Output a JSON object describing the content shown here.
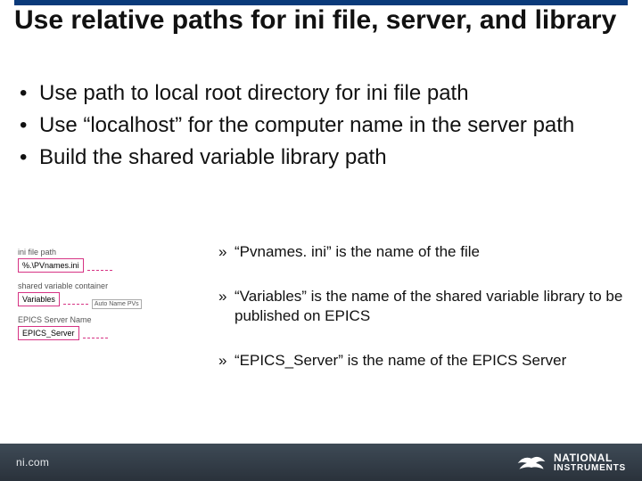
{
  "title": "Use relative paths for ini file, server, and library",
  "bullets": [
    "Use path to local root directory for ini file path",
    "Use “localhost” for the computer name in the server path",
    "Build the shared variable library path"
  ],
  "diagram": {
    "row1_label": "ini file path",
    "row1_box": "%.\\PVnames.ini",
    "row2_label": "shared variable container",
    "row2_box": "Variables",
    "row2_aux": "Auto\nName\nPVs",
    "row3_label": "EPICS Server Name",
    "row3_box": "EPICS_Server"
  },
  "sub_bullets": [
    "“Pvnames. ini” is the name of the file",
    "“Variables” is the name of the shared variable library to be published on EPICS",
    "“EPICS_Server” is the name of the EPICS Server"
  ],
  "footer": {
    "url": "ni.com",
    "brand_top": "NATIONAL",
    "brand_bottom": "INSTRUMENTS"
  }
}
